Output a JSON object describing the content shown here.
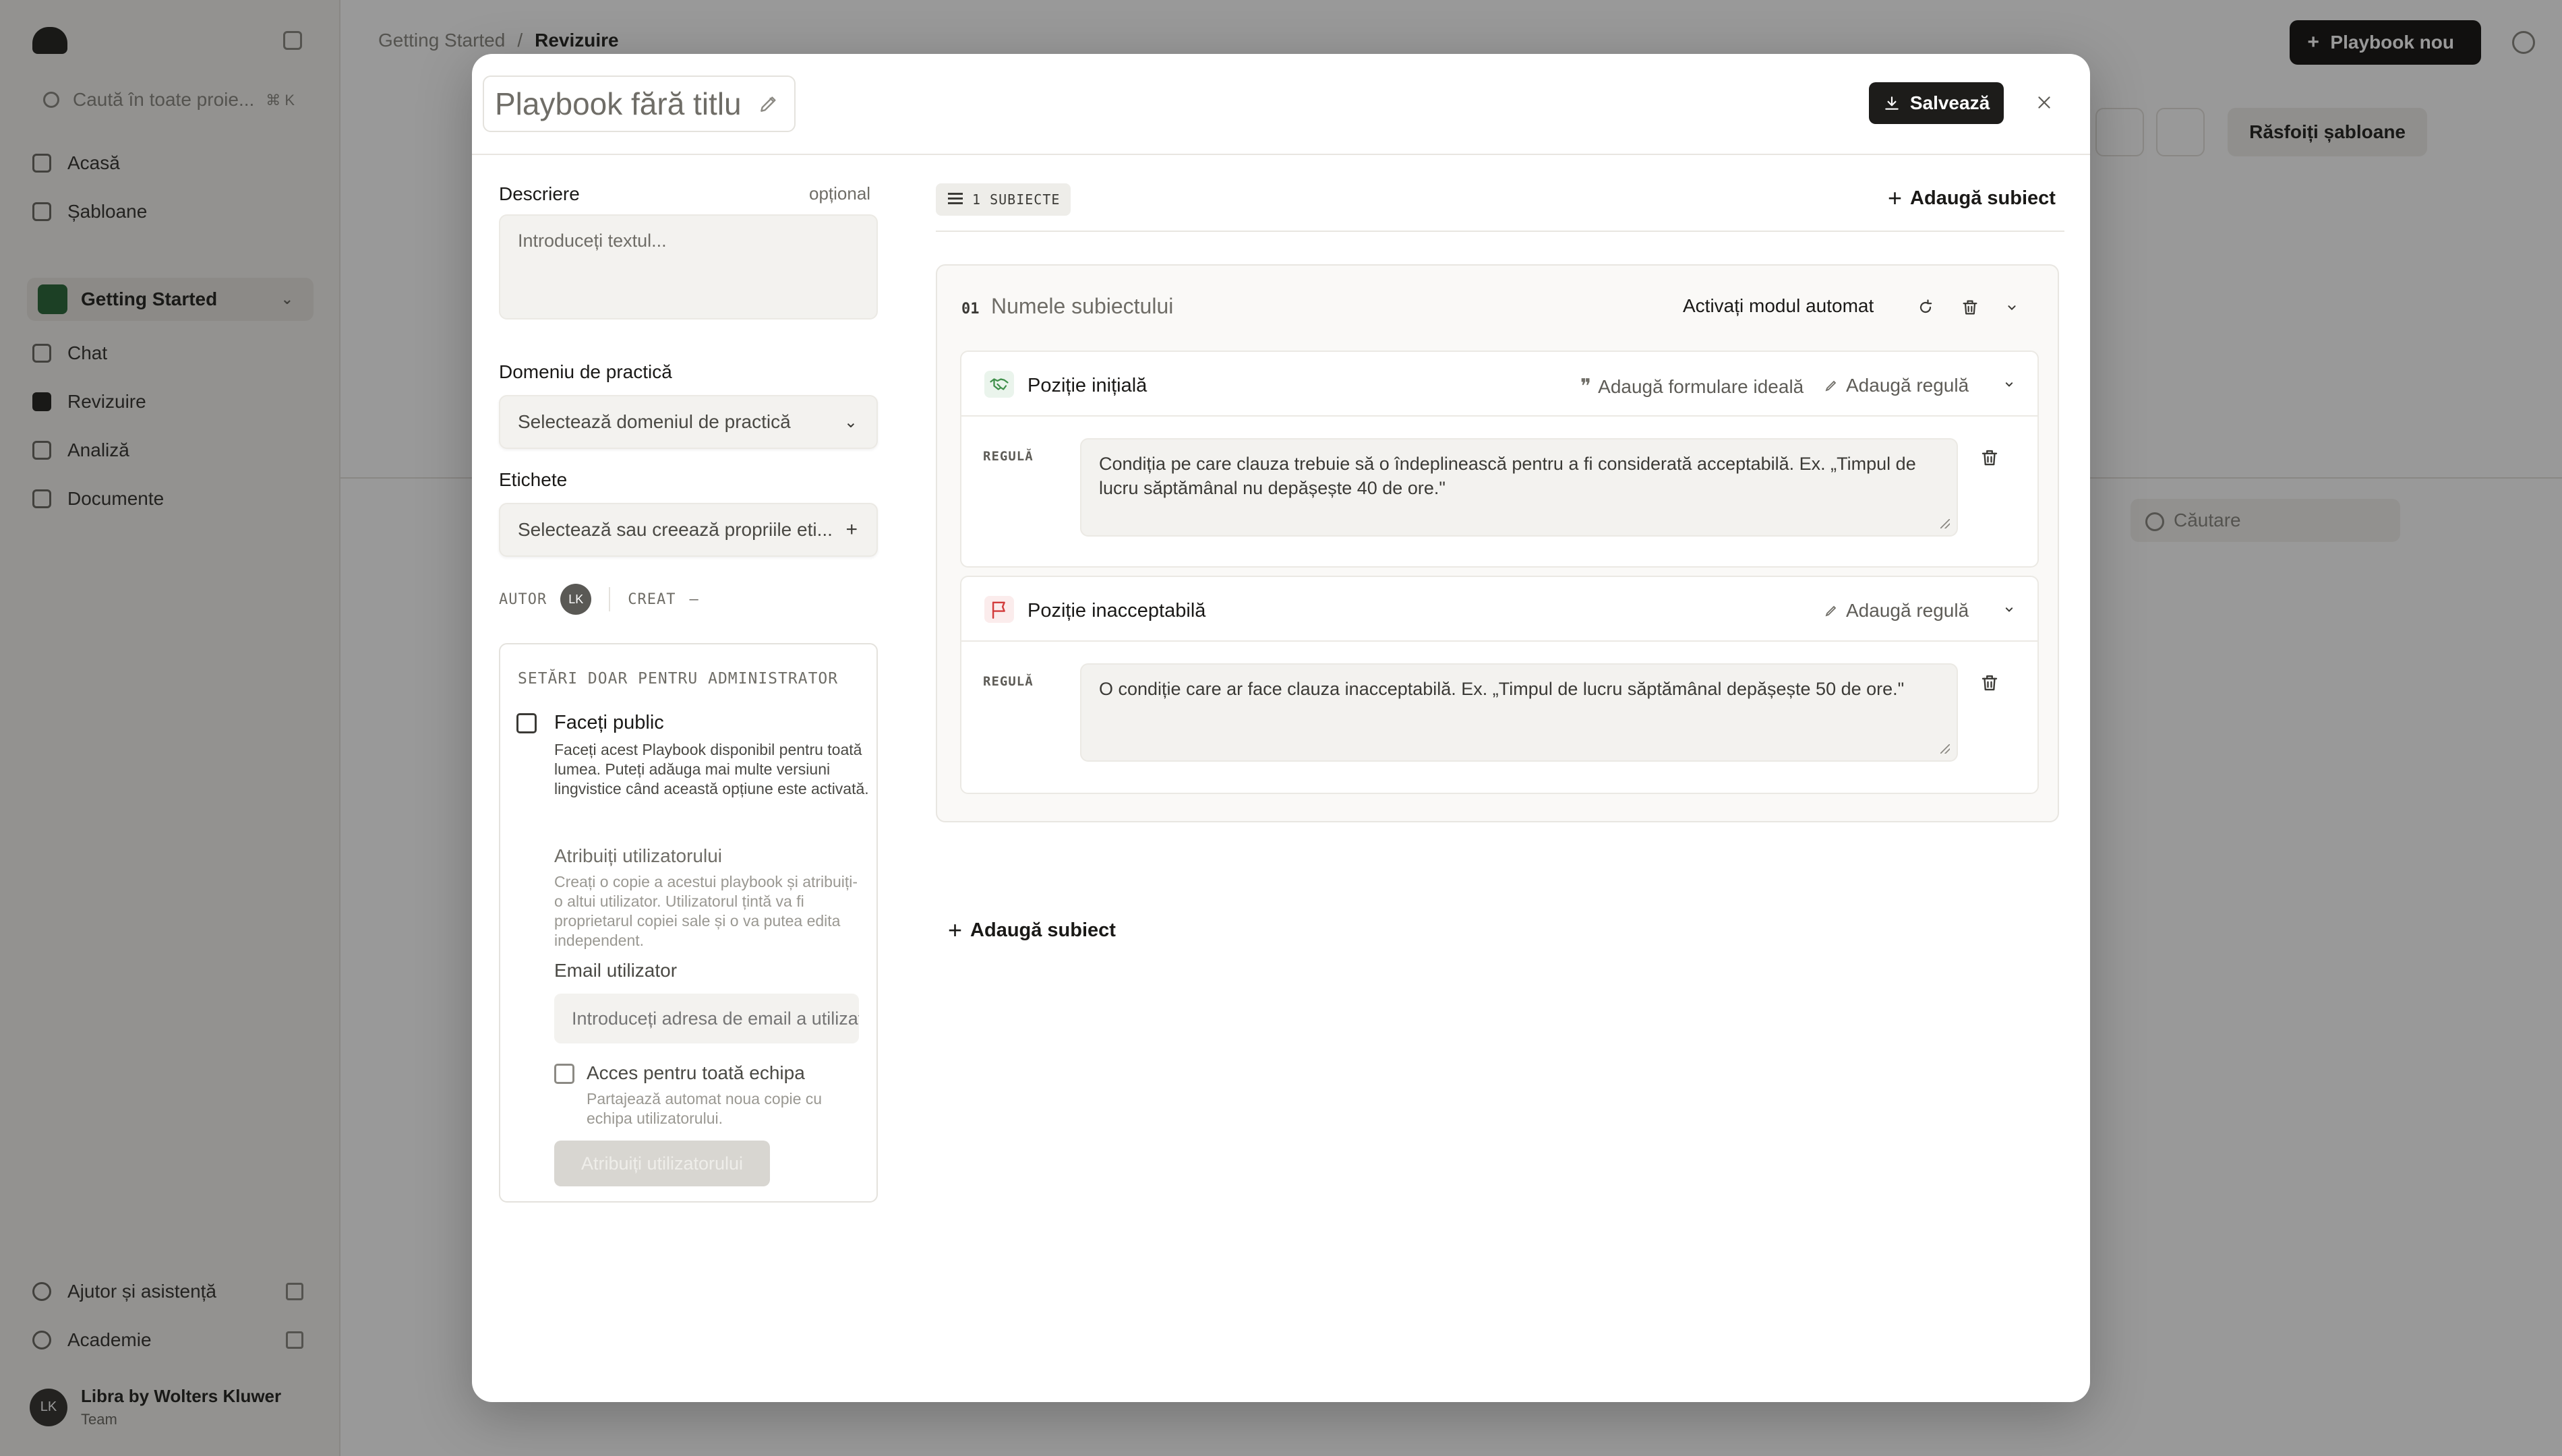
{
  "background": {
    "sidebar": {
      "search_placeholder": "Caută în toate proie...",
      "search_shortcut": "⌘ K",
      "nav": [
        "Acasă",
        "Șabloane"
      ],
      "workspace": "Getting Started",
      "workspace_nav": [
        "Chat",
        "Revizuire",
        "Analiză",
        "Documente"
      ],
      "footer": [
        "Ajutor și asistență",
        "Academie"
      ],
      "user_name": "Libra by Wolters Kluwer",
      "user_team": "Team",
      "user_initials": "LK"
    },
    "breadcrumb": [
      "Getting Started",
      "/",
      "Revizuire"
    ],
    "new_button": "Playbook nou",
    "reset_button": "Răsfoiți șabloane",
    "search_placeholder": "Căutare"
  },
  "modal": {
    "title": "Playbook fără titlu",
    "save_label": "Salvează",
    "left": {
      "description_label": "Descriere",
      "description_optional": "opțional",
      "description_placeholder": "Introduceți textul...",
      "practice_label": "Domeniu de practică",
      "practice_placeholder": "Selectează domeniul de practică",
      "tags_label": "Etichete",
      "tags_placeholder": "Selectează sau creează propriile eti...",
      "author_label": "AUTOR",
      "author_initials": "LK",
      "created_label": "CREAT",
      "created_value": "–",
      "admin": {
        "title": "SETĂRI DOAR PENTRU ADMINISTRATOR",
        "public_label": "Faceți public",
        "public_help": "Faceți acest Playbook disponibil pentru toată lumea. Puteți adăuga mai multe versiuni lingvistice când această opțiune este activată.",
        "assign_title": "Atribuiți utilizatorului",
        "assign_help": "Creați o copie a acestui playbook și atribuiți-o altui utilizator. Utilizatorul țintă va fi proprietarul copiei sale și o va putea edita independent.",
        "email_label": "Email utilizator",
        "email_placeholder": "Introduceți adresa de email a utilizatorului",
        "team_label": "Acces pentru toată echipa",
        "team_help": "Partajează automat noua copie cu echipa utilizatorului.",
        "assign_button": "Atribuiți utilizatorului"
      }
    },
    "right": {
      "subject_count": "1 SUBIECTE",
      "add_subject": "Adaugă subiect",
      "subject": {
        "number": "01",
        "name_placeholder": "Numele subiectului",
        "auto_mode": "Activați modul automat",
        "initial": {
          "title": "Poziție inițială",
          "add_ideal": "Adaugă formulare ideală",
          "add_rule": "Adaugă regulă",
          "rule_label": "REGULĂ",
          "rule_text": "Condiția pe care clauza trebuie să o îndeplinească pentru a fi considerată acceptabilă. Ex. „Timpul de lucru săptămânal nu depășește 40 de ore.\""
        },
        "unacceptable": {
          "title": "Poziție inacceptabilă",
          "add_rule": "Adaugă regulă",
          "rule_label": "REGULĂ",
          "rule_text": "O condiție care ar face clauza inacceptabilă. Ex. „Timpul de lucru săptămânal depășește 50 de ore.\""
        }
      },
      "add_subject_bottom": "Adaugă subiect"
    }
  },
  "colors": {
    "primary": "#1d1c1a",
    "initial_icon": "#3f8f4a",
    "unacceptable_icon": "#d23b3b",
    "overlay": "rgba(0,0,0,0.40)"
  }
}
